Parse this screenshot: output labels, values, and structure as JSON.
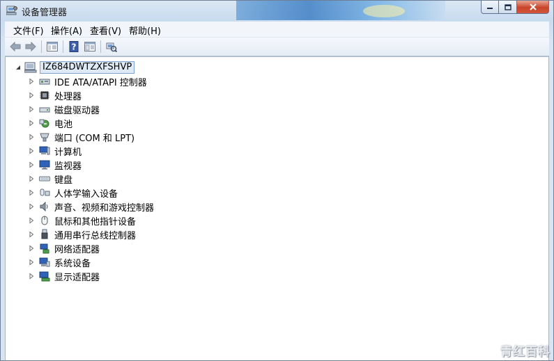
{
  "window": {
    "title": "设备管理器",
    "buttons": {
      "minimize": "minimize-icon",
      "maximize": "maximize-icon",
      "close": "close-icon"
    }
  },
  "menu": [
    "文件(F)",
    "操作(A)",
    "查看(V)",
    "帮助(H)"
  ],
  "toolbar": [
    "back-arrow-icon",
    "forward-arrow-icon",
    "console-tree-icon",
    "help-icon",
    "properties-icon",
    "scan-hardware-icon"
  ],
  "tree": {
    "root": "IZ684DWTZXFSHVP",
    "items": [
      {
        "label": "IDE ATA/ATAPI 控制器",
        "icon": "ide-controller-icon"
      },
      {
        "label": "处理器",
        "icon": "processor-icon"
      },
      {
        "label": "磁盘驱动器",
        "icon": "disk-drive-icon"
      },
      {
        "label": "电池",
        "icon": "battery-icon"
      },
      {
        "label": "端口 (COM 和 LPT)",
        "icon": "port-icon"
      },
      {
        "label": "计算机",
        "icon": "computer-icon"
      },
      {
        "label": "监视器",
        "icon": "monitor-icon"
      },
      {
        "label": "键盘",
        "icon": "keyboard-icon"
      },
      {
        "label": "人体学输入设备",
        "icon": "hid-icon"
      },
      {
        "label": "声音、视频和游戏控制器",
        "icon": "sound-icon"
      },
      {
        "label": "鼠标和其他指针设备",
        "icon": "mouse-icon"
      },
      {
        "label": "通用串行总线控制器",
        "icon": "usb-icon"
      },
      {
        "label": "网络适配器",
        "icon": "network-adapter-icon"
      },
      {
        "label": "系统设备",
        "icon": "system-device-icon"
      },
      {
        "label": "显示适配器",
        "icon": "display-adapter-icon"
      }
    ]
  },
  "watermark": "青红百科"
}
